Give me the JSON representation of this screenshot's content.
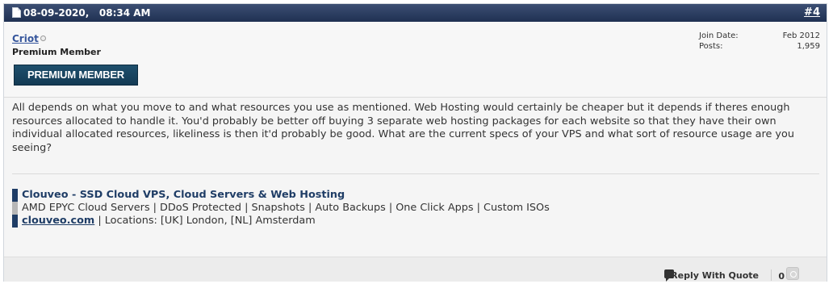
{
  "post": {
    "date": "08-09-2020,",
    "time": "08:34 AM",
    "number": "#4"
  },
  "user": {
    "name": "Criot",
    "title": "Premium Member",
    "badge": "PREMIUM MEMBER",
    "join_label": "Join Date:",
    "join_value": "Feb 2012",
    "posts_label": "Posts:",
    "posts_value": "1,959"
  },
  "message": "All depends on what you move to and what resources you use as mentioned. Web Hosting would certainly be cheaper but it depends if theres enough resources allocated to handle it. You'd probably be better off buying 3 separate web hosting packages for each website so that they have their own individual allocated resources, likeliness is then it'd probably be good. What are the current specs of your VPS and what sort of resource usage are you seeing?",
  "signature": {
    "line1": "Clouveo - SSD Cloud VPS, Cloud Servers & Web Hosting",
    "line2": "AMD EPYC Cloud Servers | DDoS Protected | Snapshots | Auto Backups | One Click Apps | Custom ISOs",
    "line3_link": "clouveo.com",
    "line3_rest": " | Locations: [UK] London, [NL] Amsterdam",
    "bar_colors": [
      "#1f3d66",
      "#b7b7b7",
      "#1f3d66"
    ]
  },
  "footer": {
    "reply_label": "Reply With Quote",
    "like_count": "0"
  }
}
